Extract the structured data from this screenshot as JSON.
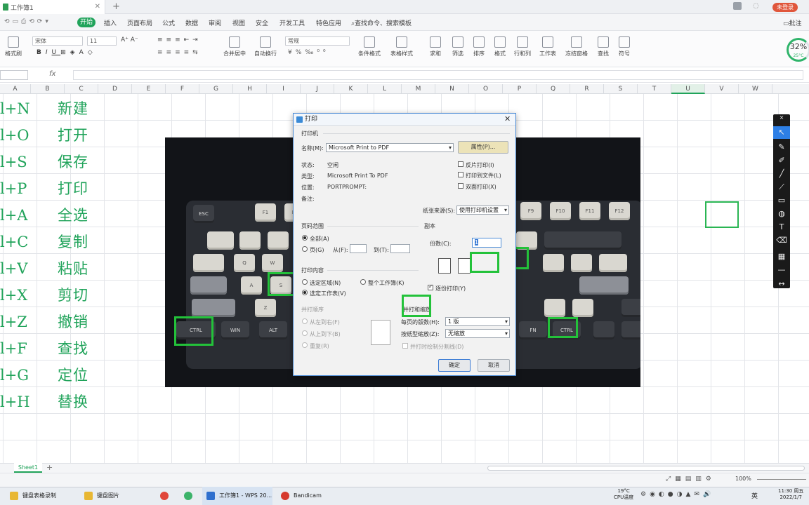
{
  "app": {
    "doc_tab": "工作簿1",
    "login_label": "未登录",
    "menus": [
      "开始",
      "插入",
      "页面布局",
      "公式",
      "数据",
      "审阅",
      "视图",
      "安全",
      "开发工具",
      "特色应用",
      "查找命令、搜索模板"
    ],
    "active_menu": "开始",
    "batch_label": "批注"
  },
  "ribbon": {
    "paste": "粘贴",
    "format_painter": "格式刷",
    "font_name": "宋体",
    "font_size": "11",
    "merge_center": "合并居中",
    "wrap": "自动换行",
    "number_format": "常规",
    "cond_format": "条件格式",
    "table_style": "表格样式",
    "sum": "求和",
    "filter": "筛选",
    "sort": "排序",
    "format": "格式",
    "rowcol": "行和列",
    "worksheet": "工作表",
    "freeze": "冻结窗格",
    "find": "查找",
    "symbol": "符号",
    "perf_percent": "32%",
    "perf_temp": "25°C"
  },
  "formula_bar": {
    "fx": "fx"
  },
  "columns": [
    "A",
    "B",
    "C",
    "D",
    "E",
    "F",
    "G",
    "H",
    "I",
    "J",
    "K",
    "L",
    "M",
    "N",
    "O",
    "P",
    "Q",
    "R",
    "S",
    "T",
    "U",
    "V",
    "W"
  ],
  "cells": {
    "shortcuts": [
      "l+N",
      "l+O",
      "l+S",
      "l+P",
      "l+A",
      "l+C",
      "l+V",
      "l+X",
      "l+Z",
      "l+F",
      "l+G",
      "l+H"
    ],
    "actions": [
      "新建",
      "打开",
      "保存",
      "打印",
      "全选",
      "复制",
      "粘贴",
      "剪切",
      "撤销",
      "查找",
      "定位",
      "替换"
    ]
  },
  "keyboard_keys": [
    "ESC",
    "F1",
    "F2",
    "F9",
    "F10",
    "F11",
    "F12",
    "Q",
    "W",
    "A",
    "S",
    "Z",
    "CTRL",
    "WIN",
    "ALT",
    "FN",
    "CTRL"
  ],
  "dialog": {
    "title": "打印",
    "printer_group": "打印机",
    "name_label": "名称(M):",
    "printer_name": "Microsoft Print to PDF",
    "properties_btn": "属性(P)...",
    "status_label": "状态:",
    "status_value": "空闲",
    "type_label": "类型:",
    "type_value": "Microsoft Print To PDF",
    "location_label": "位置:",
    "location_value": "PORTPROMPT:",
    "comment_label": "备注:",
    "reverse_print": "反片打印(I)",
    "print_to_file": "打印到文件(L)",
    "duplex": "双面打印(X)",
    "paper_source_label": "纸张来源(S):",
    "paper_source_value": "使用打印机设置",
    "range_group": "页码范围",
    "all_pages": "全部(A)",
    "pages": "页(G)",
    "from_label": "从(F):",
    "to_label": "到(T):",
    "copies_group": "副本",
    "copies_label": "份数(C):",
    "copies_value": "1",
    "collate": "逐份打印(Y)",
    "content_group": "打印内容",
    "selection": "选定区域(N)",
    "whole_workbook": "整个工作簿(K)",
    "selected_sheet": "选定工作表(V)",
    "order_group": "并打顺序",
    "left_to_right": "从左到右(F)",
    "top_to_bottom": "从上到下(B)",
    "repeat": "重复(R)",
    "zoom_group": "并打和缩放",
    "pages_per_sheet_label": "每页的版数(H):",
    "pages_per_sheet_value": "1 版",
    "scale_label": "按纸型缩放(Z):",
    "scale_value": "无缩放",
    "draw_borders": "并打时绘制分割线(D)",
    "ok": "确定",
    "cancel": "取消"
  },
  "sheet_tab": "Sheet1",
  "status": {
    "zoom": "100%"
  },
  "taskbar": {
    "items": [
      "键盘表格录制",
      "键盘图片",
      "工作簿1 - WPS 20...",
      "Bandicam"
    ],
    "weather": "19°C",
    "cpu": "CPU温度",
    "time": "11:30 周五",
    "date": "2022/1/7",
    "ime": "英"
  },
  "colors": {
    "accent": "#20a35a",
    "highlight_box": "#23c23a",
    "dialog_border": "#4d8cd6"
  }
}
